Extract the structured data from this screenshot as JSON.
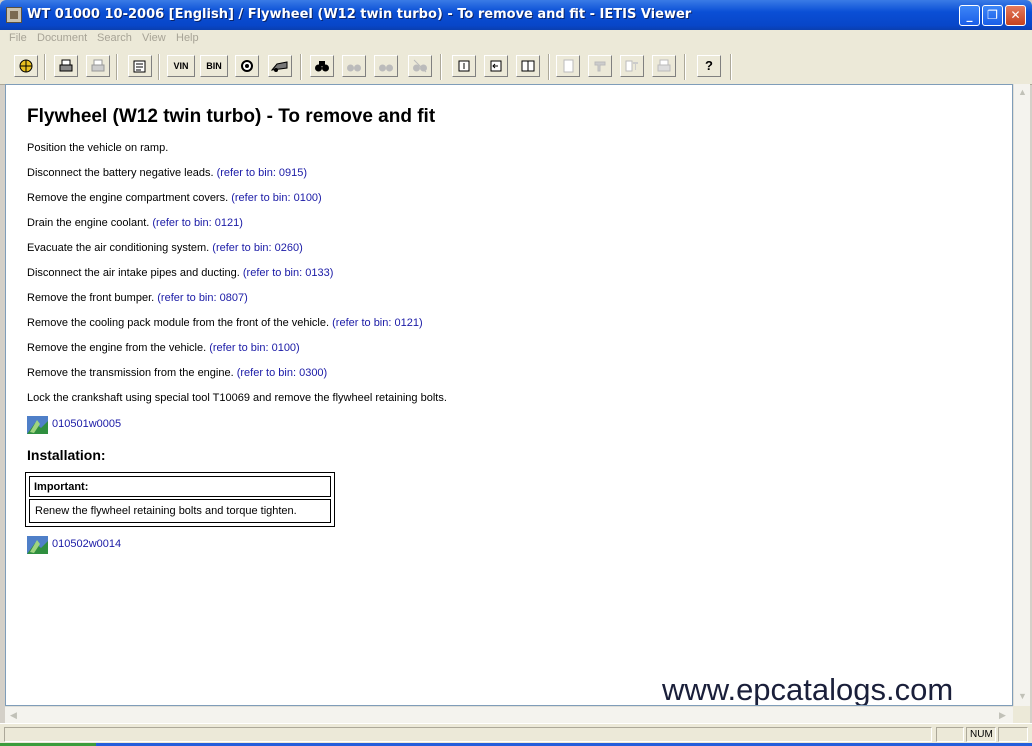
{
  "window": {
    "title": "WT 01000 10-2006 [English] / Flywheel (W12 twin turbo) - To remove and fit - IETIS Viewer",
    "minimize": "_",
    "maximize": "❐",
    "close": "✕"
  },
  "menu": [
    "File",
    "Document",
    "Search",
    "View",
    "Help"
  ],
  "toolbar": {
    "vin_label": "VIN",
    "bin_label": "BIN",
    "help_label": "?"
  },
  "document": {
    "title": "Flywheel (W12 twin turbo) - To remove and fit",
    "steps": [
      {
        "text": "Position the vehicle on ramp.",
        "ref": ""
      },
      {
        "text": "Disconnect the battery negative leads.",
        "ref": "(refer to bin: 0915)"
      },
      {
        "text": "Remove the engine compartment covers.",
        "ref": "(refer to bin: 0100)"
      },
      {
        "text": "Drain the engine coolant.",
        "ref": "(refer to bin: 0121)"
      },
      {
        "text": "Evacuate the air conditioning system.",
        "ref": "(refer to bin: 0260)"
      },
      {
        "text": "Disconnect the air intake pipes and ducting.",
        "ref": "(refer to bin: 0133)"
      },
      {
        "text": "Remove the front bumper.",
        "ref": "(refer to bin: 0807)"
      },
      {
        "text": "Remove the cooling pack module from the front of the vehicle.",
        "ref": "(refer to bin: 0121)"
      },
      {
        "text": "Remove the engine from the vehicle.",
        "ref": "(refer to bin: 0100)"
      },
      {
        "text": "Remove the transmission from the engine.",
        "ref": "(refer to bin: 0300)"
      },
      {
        "text": "Lock the crankshaft using special tool T10069 and remove the flywheel retaining bolts.",
        "ref": ""
      }
    ],
    "image_link_1": "010501w0005",
    "installation_heading": "Installation:",
    "important_label": "Important:",
    "important_text": "Renew the flywheel retaining bolts and torque tighten.",
    "image_link_2": "010502w0014"
  },
  "watermark": "www.epcatalogs.com",
  "status": {
    "num": "NUM"
  },
  "colors": {
    "titlebar": "#0a4fd6",
    "link": "#1a1aa6",
    "chrome": "#ece9d8"
  }
}
